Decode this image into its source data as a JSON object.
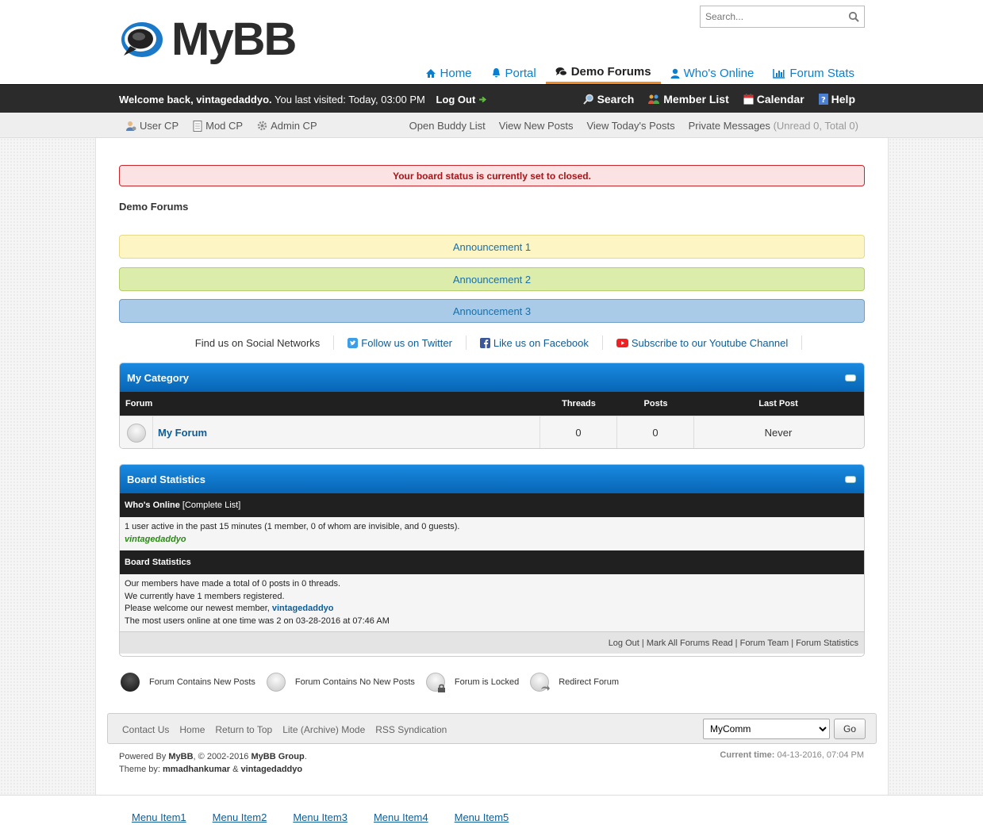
{
  "header": {
    "logo_text": "MyBB",
    "search_placeholder": "Search...",
    "nav": [
      {
        "label": "Home",
        "icon": "home-icon"
      },
      {
        "label": "Portal",
        "icon": "bell-icon"
      },
      {
        "label": "Demo Forums",
        "icon": "comments-icon",
        "active": true
      },
      {
        "label": "Who's Online",
        "icon": "user-icon"
      },
      {
        "label": "Forum Stats",
        "icon": "bar-chart-icon"
      }
    ]
  },
  "welcome_bar": {
    "welcome": "Welcome back, vintagedaddyo.",
    "last_visited": "You last visited: Today, 03:00 PM",
    "logout": "Log Out",
    "links": [
      "Search",
      "Member List",
      "Calendar",
      "Help"
    ]
  },
  "user_bar": {
    "left": [
      "User CP",
      "Mod CP",
      "Admin CP"
    ],
    "right": [
      "Open Buddy List",
      "View New Posts",
      "View Today's Posts"
    ],
    "pm_label": "Private Messages",
    "pm_count": "(Unread 0, Total 0)"
  },
  "alert": "Your board status is currently set to closed.",
  "breadcrumb": "Demo Forums",
  "announcements": [
    "Announcement 1",
    "Announcement 2",
    "Announcement 3"
  ],
  "social": {
    "label": "Find us on Social Networks",
    "twitter": "Follow us on Twitter",
    "facebook": "Like us on Facebook",
    "youtube": "Subscribe to our Youtube Channel"
  },
  "category": {
    "title": "My Category",
    "columns": [
      "Forum",
      "Threads",
      "Posts",
      "Last Post"
    ],
    "rows": [
      {
        "forum": "My Forum",
        "threads": "0",
        "posts": "0",
        "last_post": "Never"
      }
    ]
  },
  "board_stats": {
    "title": "Board Statistics",
    "whos_online_header": "Who's Online",
    "complete_list": "[Complete List]",
    "online_text": "1 user active in the past 15 minutes (1 member, 0 of whom are invisible, and 0 guests).",
    "online_user": "vintagedaddyo",
    "stats_header": "Board Statistics",
    "line1": "Our members have made a total of 0 posts in 0 threads.",
    "line2": "We currently have 1 members registered.",
    "line3": "Please welcome our newest member,",
    "newest_member": "vintagedaddyo",
    "line4": "The most users online at one time was 2 on 03-28-2016 at 07:46 AM",
    "footer_links": [
      "Log Out",
      "Mark All Forums Read",
      "Forum Team",
      "Forum Statistics"
    ]
  },
  "legend": [
    "Forum Contains New Posts",
    "Forum Contains No New Posts",
    "Forum is Locked",
    "Redirect Forum"
  ],
  "footer": {
    "links": [
      "Contact Us",
      "Home",
      "Return to Top",
      "Lite (Archive) Mode",
      "RSS Syndication"
    ],
    "theme_select": "MyComm",
    "go": "Go"
  },
  "copyright": {
    "powered_prefix": "Powered By",
    "mybb": "MyBB",
    "powered_suffix": ", © 2002-2016",
    "group": "MyBB Group",
    "theme_by": "Theme by:",
    "author1": "mmadhankumar",
    "amp": "&",
    "author2": "vintagedaddyo",
    "current_time_label": "Current time:",
    "current_time": "04-13-2016, 07:04 PM"
  },
  "menu": [
    "Menu Item1",
    "Menu Item2",
    "Menu Item3",
    "Menu Item4",
    "Menu Item5"
  ],
  "colors": {
    "accent": "#0765b5",
    "nav_active_underline": "#f08a24",
    "dark_bar": "#2b2b2b",
    "alert_bg": "#fbe3e4",
    "online_user": "#2a8a14"
  }
}
